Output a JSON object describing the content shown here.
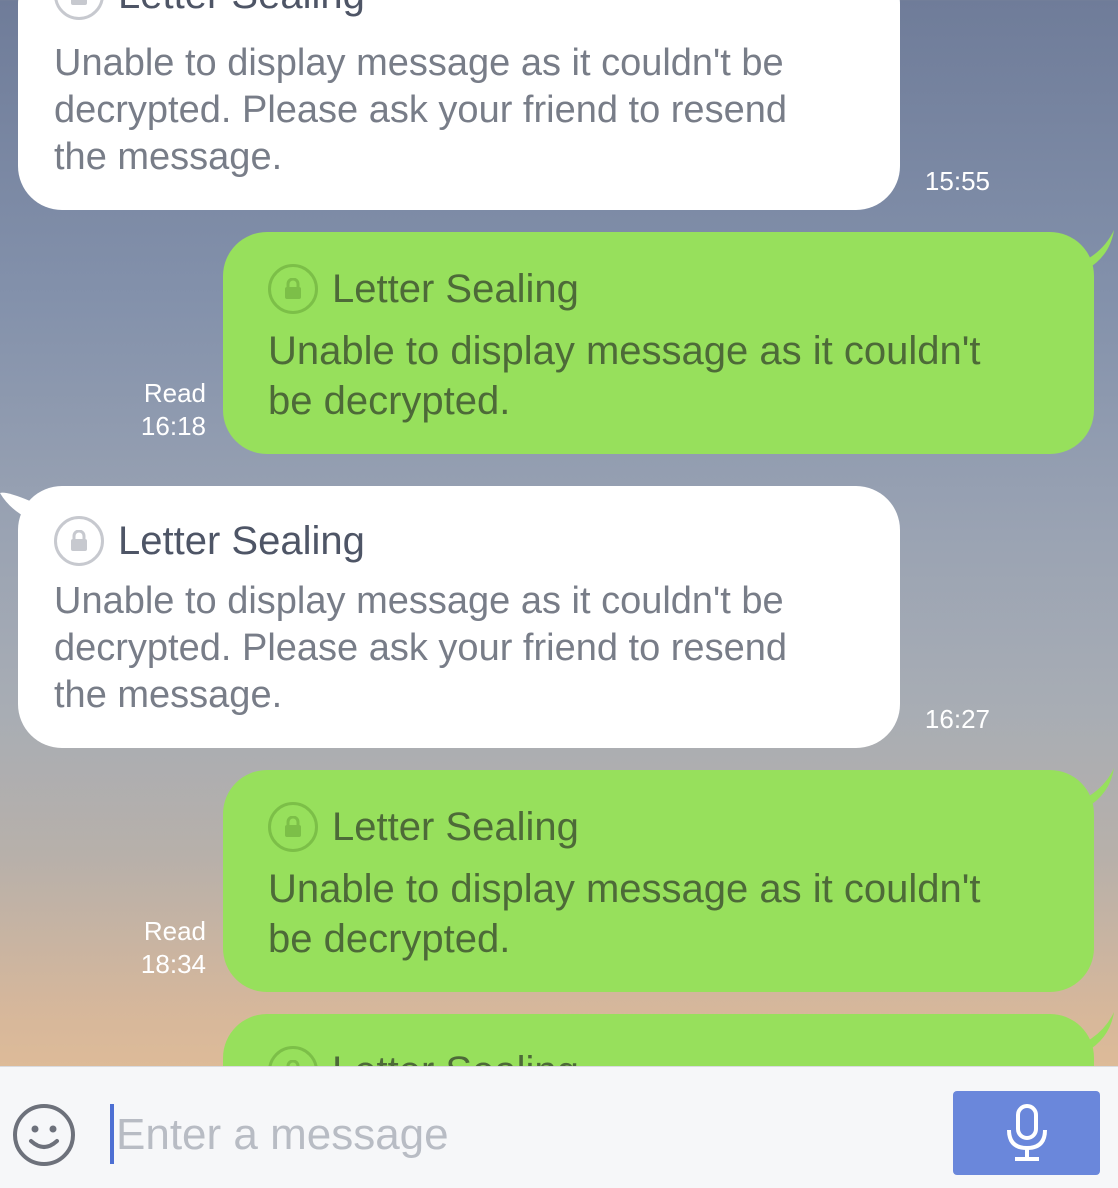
{
  "messages": [
    {
      "direction": "incoming",
      "title": "Letter Sealing",
      "body_lines": [
        "Unable to display message as it couldn't be",
        "decrypted. Please ask your friend to resend",
        "the message."
      ],
      "time": "15:55"
    },
    {
      "direction": "outgoing",
      "title": "Letter Sealing",
      "body_lines": [
        "Unable to display message as it couldn't",
        "be decrypted."
      ],
      "read": "Read",
      "time": "16:18"
    },
    {
      "direction": "incoming",
      "title": "Letter Sealing",
      "body_lines": [
        "Unable to display message as it couldn't be",
        "decrypted. Please ask your friend to resend",
        "the message."
      ],
      "time": "16:27"
    },
    {
      "direction": "outgoing",
      "title": "Letter Sealing",
      "body_lines": [
        "Unable to display message as it couldn't",
        "be decrypted."
      ],
      "read": "Read",
      "time": "18:34"
    },
    {
      "direction": "outgoing",
      "title": "Letter Sealing",
      "body_lines": []
    }
  ],
  "composer": {
    "placeholder": "Enter a message",
    "emoji_icon": "smiley-icon",
    "mic_icon": "microphone-icon"
  },
  "colors": {
    "incoming_bubble": "#ffffff",
    "outgoing_bubble": "#97e05c",
    "mic_button": "#6a87db"
  }
}
